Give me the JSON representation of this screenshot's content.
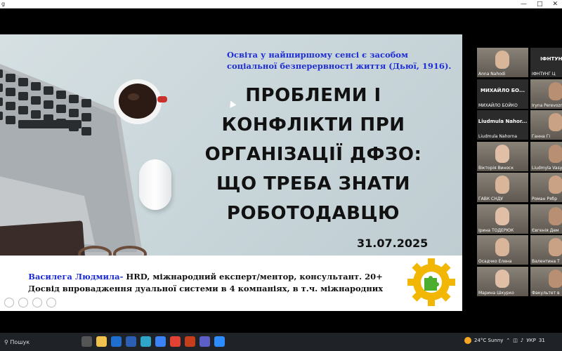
{
  "window": {
    "title": "g"
  },
  "slide": {
    "quote": "Освіта у найширшому сенсі є засобом соціальної безперервності життя (Дьюї, 1916).",
    "title": "ПРОБЛЕМИ І КОНФЛІКТИ ПРИ ОРГАНІЗАЦІЇ ДФЗО: ЩО ТРЕБА ЗНАТИ РОБОТОДАВЦЮ",
    "date": "31.07.2025",
    "author_name": "Василега Людмила-",
    "author_desc": " HRD, міжнародний експерт/ментор, консультант. 20+ Досвід впровадження дуальної системи в 4 компаніях, в т.ч. міжнародних"
  },
  "participants": [
    {
      "name": "Anna Nahodi",
      "type": "video",
      "center": ""
    },
    {
      "name": "ІФНТУНГ Ц",
      "type": "name",
      "center": "ІФНТУНГ Ц"
    },
    {
      "name": "МИХАЙЛО БОЙКО",
      "type": "name",
      "center": "МИХАЙЛО БО..."
    },
    {
      "name": "Iryna Perevozni",
      "type": "video",
      "center": ""
    },
    {
      "name": "Liudmula Nahorna",
      "type": "name",
      "center": "Liudmula Nahor..."
    },
    {
      "name": "Ганна Гі",
      "type": "video",
      "center": ""
    },
    {
      "name": "Вікторія Виноск",
      "type": "video",
      "center": ""
    },
    {
      "name": "Liudmyla Vasyle",
      "type": "video",
      "center": ""
    },
    {
      "name": "ГАВК СНДУ",
      "type": "video",
      "center": ""
    },
    {
      "name": "Роман Рябр",
      "type": "video",
      "center": ""
    },
    {
      "name": "Ірина ТОДЕРЮК",
      "type": "video",
      "center": ""
    },
    {
      "name": "Євгенія Дем",
      "type": "video",
      "center": ""
    },
    {
      "name": "Осадчко Елена",
      "type": "video",
      "center": ""
    },
    {
      "name": "Валентина Т",
      "type": "video",
      "center": ""
    },
    {
      "name": "Марина Шкурко",
      "type": "video",
      "center": ""
    },
    {
      "name": "Факультет в",
      "type": "video",
      "center": ""
    }
  ],
  "taskbar": {
    "search_placeholder": "Пошук",
    "weather": "24°C  Sunny",
    "lang": "УКР",
    "time": "31"
  }
}
